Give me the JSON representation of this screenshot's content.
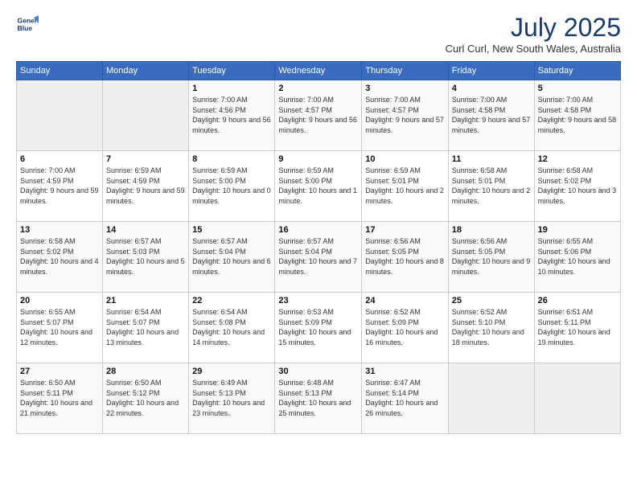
{
  "header": {
    "logo_line1": "General",
    "logo_line2": "Blue",
    "month_year": "July 2025",
    "location": "Curl Curl, New South Wales, Australia"
  },
  "days_of_week": [
    "Sunday",
    "Monday",
    "Tuesday",
    "Wednesday",
    "Thursday",
    "Friday",
    "Saturday"
  ],
  "weeks": [
    [
      {
        "day": "",
        "empty": true
      },
      {
        "day": "",
        "empty": true
      },
      {
        "day": "1",
        "sunrise": "7:00 AM",
        "sunset": "4:56 PM",
        "daylight": "9 hours and 56 minutes."
      },
      {
        "day": "2",
        "sunrise": "7:00 AM",
        "sunset": "4:57 PM",
        "daylight": "9 hours and 56 minutes."
      },
      {
        "day": "3",
        "sunrise": "7:00 AM",
        "sunset": "4:57 PM",
        "daylight": "9 hours and 57 minutes."
      },
      {
        "day": "4",
        "sunrise": "7:00 AM",
        "sunset": "4:58 PM",
        "daylight": "9 hours and 57 minutes."
      },
      {
        "day": "5",
        "sunrise": "7:00 AM",
        "sunset": "4:58 PM",
        "daylight": "9 hours and 58 minutes."
      }
    ],
    [
      {
        "day": "6",
        "sunrise": "7:00 AM",
        "sunset": "4:59 PM",
        "daylight": "9 hours and 59 minutes."
      },
      {
        "day": "7",
        "sunrise": "6:59 AM",
        "sunset": "4:59 PM",
        "daylight": "9 hours and 59 minutes."
      },
      {
        "day": "8",
        "sunrise": "6:59 AM",
        "sunset": "5:00 PM",
        "daylight": "10 hours and 0 minutes."
      },
      {
        "day": "9",
        "sunrise": "6:59 AM",
        "sunset": "5:00 PM",
        "daylight": "10 hours and 1 minute."
      },
      {
        "day": "10",
        "sunrise": "6:59 AM",
        "sunset": "5:01 PM",
        "daylight": "10 hours and 2 minutes."
      },
      {
        "day": "11",
        "sunrise": "6:58 AM",
        "sunset": "5:01 PM",
        "daylight": "10 hours and 2 minutes."
      },
      {
        "day": "12",
        "sunrise": "6:58 AM",
        "sunset": "5:02 PM",
        "daylight": "10 hours and 3 minutes."
      }
    ],
    [
      {
        "day": "13",
        "sunrise": "6:58 AM",
        "sunset": "5:02 PM",
        "daylight": "10 hours and 4 minutes."
      },
      {
        "day": "14",
        "sunrise": "6:57 AM",
        "sunset": "5:03 PM",
        "daylight": "10 hours and 5 minutes."
      },
      {
        "day": "15",
        "sunrise": "6:57 AM",
        "sunset": "5:04 PM",
        "daylight": "10 hours and 6 minutes."
      },
      {
        "day": "16",
        "sunrise": "6:57 AM",
        "sunset": "5:04 PM",
        "daylight": "10 hours and 7 minutes."
      },
      {
        "day": "17",
        "sunrise": "6:56 AM",
        "sunset": "5:05 PM",
        "daylight": "10 hours and 8 minutes."
      },
      {
        "day": "18",
        "sunrise": "6:56 AM",
        "sunset": "5:05 PM",
        "daylight": "10 hours and 9 minutes."
      },
      {
        "day": "19",
        "sunrise": "6:55 AM",
        "sunset": "5:06 PM",
        "daylight": "10 hours and 10 minutes."
      }
    ],
    [
      {
        "day": "20",
        "sunrise": "6:55 AM",
        "sunset": "5:07 PM",
        "daylight": "10 hours and 12 minutes."
      },
      {
        "day": "21",
        "sunrise": "6:54 AM",
        "sunset": "5:07 PM",
        "daylight": "10 hours and 13 minutes."
      },
      {
        "day": "22",
        "sunrise": "6:54 AM",
        "sunset": "5:08 PM",
        "daylight": "10 hours and 14 minutes."
      },
      {
        "day": "23",
        "sunrise": "6:53 AM",
        "sunset": "5:09 PM",
        "daylight": "10 hours and 15 minutes."
      },
      {
        "day": "24",
        "sunrise": "6:52 AM",
        "sunset": "5:09 PM",
        "daylight": "10 hours and 16 minutes."
      },
      {
        "day": "25",
        "sunrise": "6:52 AM",
        "sunset": "5:10 PM",
        "daylight": "10 hours and 18 minutes."
      },
      {
        "day": "26",
        "sunrise": "6:51 AM",
        "sunset": "5:11 PM",
        "daylight": "10 hours and 19 minutes."
      }
    ],
    [
      {
        "day": "27",
        "sunrise": "6:50 AM",
        "sunset": "5:11 PM",
        "daylight": "10 hours and 21 minutes."
      },
      {
        "day": "28",
        "sunrise": "6:50 AM",
        "sunset": "5:12 PM",
        "daylight": "10 hours and 22 minutes."
      },
      {
        "day": "29",
        "sunrise": "6:49 AM",
        "sunset": "5:13 PM",
        "daylight": "10 hours and 23 minutes."
      },
      {
        "day": "30",
        "sunrise": "6:48 AM",
        "sunset": "5:13 PM",
        "daylight": "10 hours and 25 minutes."
      },
      {
        "day": "31",
        "sunrise": "6:47 AM",
        "sunset": "5:14 PM",
        "daylight": "10 hours and 26 minutes."
      },
      {
        "day": "",
        "empty": true
      },
      {
        "day": "",
        "empty": true
      }
    ]
  ]
}
